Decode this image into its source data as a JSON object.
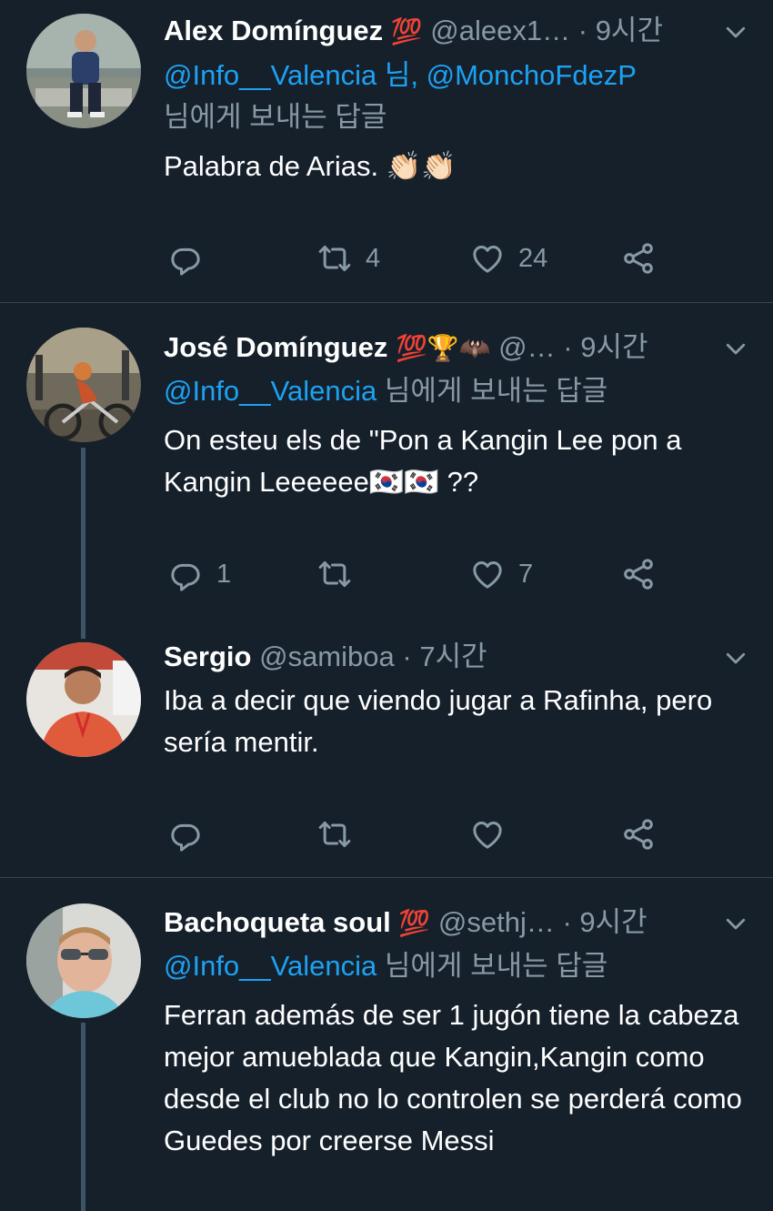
{
  "tweets": [
    {
      "name": "Alex Domínguez",
      "badges": "💯",
      "handle": "@aleex1…",
      "dot": "·",
      "time": "9시간",
      "reply_mentions": "@Info__Valencia 님, @MonchoFdezP",
      "reply_suffix": "님에게 보내는 답글",
      "text": "Palabra de Arias. 👏🏻👏🏻",
      "reply_count": "",
      "retweet_count": "4",
      "like_count": "24"
    },
    {
      "name": "José Domínguez",
      "badges": "💯🏆🦇",
      "handle": "@…",
      "dot": "·",
      "time": "9시간",
      "reply_mentions": "@Info__Valencia",
      "reply_suffix": " 님에게 보내는 답글",
      "text": "On esteu els de \"Pon a Kangin Lee pon a Kangin Leeeeee🇰🇷🇰🇷 ??",
      "reply_count": "1",
      "retweet_count": "",
      "like_count": "7"
    },
    {
      "name": "Sergio",
      "handle": "@samiboa",
      "dot": "·",
      "time": "7시간",
      "text": "Iba a decir que viendo jugar a Rafinha, pero sería mentir.",
      "reply_count": "",
      "retweet_count": "",
      "like_count": ""
    },
    {
      "name": "Bachoqueta soul",
      "badges": "💯",
      "handle": "@sethj…",
      "dot": "·",
      "time": "9시간",
      "reply_mentions": "@Info__Valencia",
      "reply_suffix": " 님에게 보내는 답글",
      "text": "Ferran además de ser 1 jugón tiene la cabeza mejor amueblada que Kangin,Kangin como desde el club no lo controlen se perderá como Guedes por creerse Messi"
    }
  ],
  "icons": {
    "reply": "reply-icon",
    "retweet": "retweet-icon",
    "like": "heart-icon",
    "share": "share-icon",
    "caret": "chevron-down-icon"
  },
  "colors": {
    "background": "#15202b",
    "secondary_text": "#8899a6",
    "link": "#1da1f2",
    "divider": "#38444d",
    "thread_line": "#3d5466"
  }
}
